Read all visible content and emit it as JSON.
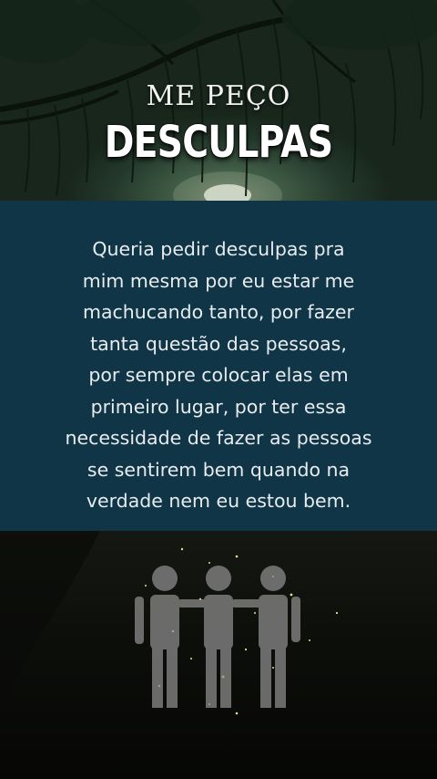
{
  "header": {
    "title_top": "ME PEÇO",
    "title_main": "DESCULPAS"
  },
  "message": {
    "text": "Queria pedir desculpas pra\nmim mesma por eu estar me\nmachucando tanto, por fazer\ntanta questão das pessoas,\npor sempre colocar elas em\nprimeiro lugar, por ter essa\nnecessidade de fazer as pessoas\nse sentirem bem quando na\nverdade nem eu estou bem."
  },
  "colors": {
    "panel": "#0f3547",
    "sky": "#3e5a44",
    "text": "#e8ecef"
  },
  "icons": {
    "top_image": "night-tree-moon-icon",
    "bottom_image": "three-people-icon"
  }
}
